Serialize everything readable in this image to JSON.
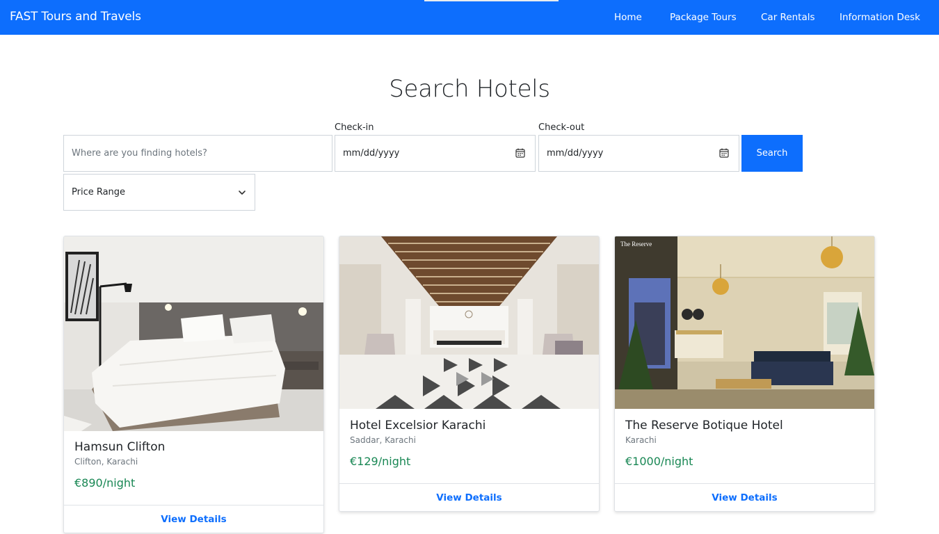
{
  "navbar": {
    "brand": "FAST Tours and Travels",
    "links": [
      "Home",
      "Package Tours",
      "Car Rentals",
      "Information Desk"
    ]
  },
  "page_title": "Search Hotels",
  "search": {
    "location_placeholder": "Where are you finding hotels?",
    "checkin_label": "Check-in",
    "checkin_value": "mm/dd/yyyy",
    "checkout_label": "Check-out",
    "checkout_value": "mm/dd/yyyy",
    "button_label": "Search",
    "price_range_label": "Price Range"
  },
  "hotels": [
    {
      "name": "Hamsun Clifton",
      "location": "Clifton, Karachi",
      "price": "€890/night",
      "action": "View Details"
    },
    {
      "name": "Hotel Excelsior Karachi",
      "location": "Saddar, Karachi",
      "price": "€129/night",
      "action": "View Details"
    },
    {
      "name": "The Reserve Botique Hotel",
      "location": "Karachi",
      "price": "€1000/night",
      "action": "View Details"
    }
  ],
  "colors": {
    "primary": "#0d6efd",
    "price": "#198754",
    "muted": "#6c757d"
  }
}
